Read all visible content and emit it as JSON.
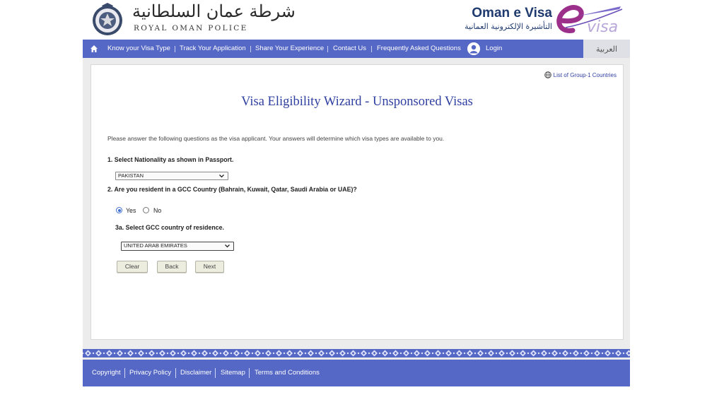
{
  "header": {
    "rop_arabic": "شرطة عمان السلطانية",
    "rop_english": "ROYAL OMAN POLICE",
    "evisa_title": "Oman e Visa",
    "evisa_arabic": "التأشيرة الإلكترونية العمانية"
  },
  "nav": {
    "items": [
      "Know your Visa Type",
      "Track Your Application",
      "Share Your Experience",
      "Contact Us",
      "Frequently Asked Questions"
    ],
    "login": "Login",
    "arabic": "العربية",
    "color": "#5668c5"
  },
  "panel": {
    "group_link": "List of Group-1 Countries",
    "title": "Visa Eligibility Wizard - Unsponsored Visas",
    "intro": "Please answer the following questions as the visa applicant. Your answers will determine which visa types are available to you.",
    "q1": "1. Select Nationality as shown in Passport.",
    "nationality": "PAKISTAN",
    "q2": "2. Are you resident in a GCC Country (Bahrain, Kuwait, Qatar, Saudi Arabia or UAE)?",
    "yes_label": "Yes",
    "no_label": "No",
    "resident_selected": "Yes",
    "q3": "3a. Select GCC country of residence.",
    "gcc_country": "UNITED ARAB EMIRATES",
    "buttons": {
      "clear": "Clear",
      "back": "Back",
      "next": "Next"
    }
  },
  "footer": {
    "links": [
      "Copyright",
      "Privacy Policy",
      "Disclaimer",
      "Sitemap",
      "Terms and Conditions"
    ]
  },
  "icons": [
    "home-icon",
    "user-icon",
    "globe-icon",
    "chevron-down-icon",
    "police-emblem-icon",
    "evisa-logo-icon"
  ]
}
